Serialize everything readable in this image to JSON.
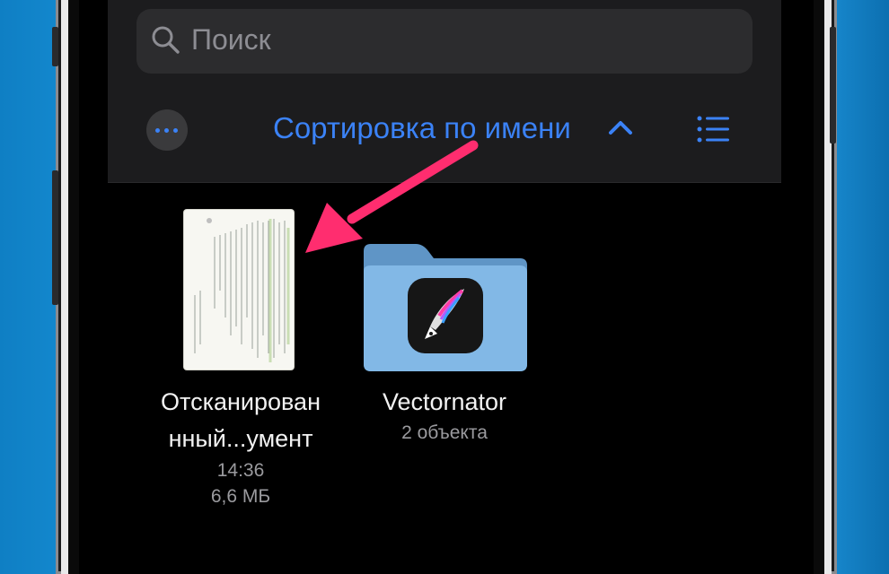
{
  "search": {
    "placeholder": "Поиск"
  },
  "toolbar": {
    "sort_label": "Сортировка по имени",
    "more_icon": "ellipsis-circle-icon",
    "view_icon": "list-view-icon"
  },
  "files": [
    {
      "name_line1": "Отсканирован",
      "name_line2": "нный...умент",
      "time": "14:36",
      "size": "6,6 МБ",
      "icon": "scanned-document-thumbnail"
    },
    {
      "name": "Vectornator",
      "meta": "2 объекта",
      "icon": "folder-icon",
      "app_icon": "vectornator-app-icon"
    }
  ],
  "annotation": {
    "arrow_color": "#ff2d6f"
  },
  "colors": {
    "accent": "#3b82f6",
    "panel": "#1c1c1e",
    "folder": "#7fb4e2"
  }
}
